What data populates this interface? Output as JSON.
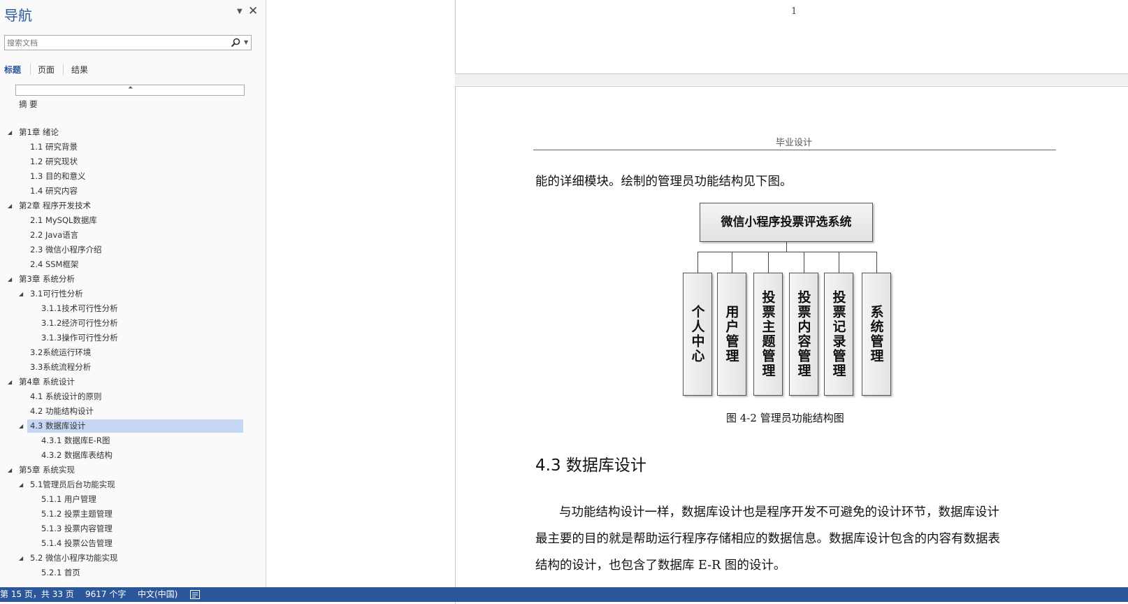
{
  "nav": {
    "title": "导航",
    "search_placeholder": "搜索文档",
    "tabs": [
      "标题",
      "页面",
      "结果"
    ],
    "headings": [
      {
        "text": "摘  要",
        "level": 0,
        "toggle": false
      },
      {
        "text": "第1章 绪论",
        "level": 0,
        "toggle": true
      },
      {
        "text": "1.1 研究背景",
        "level": 1,
        "toggle": false
      },
      {
        "text": "1.2 研究现状",
        "level": 1,
        "toggle": false
      },
      {
        "text": "1.3 目的和意义",
        "level": 1,
        "toggle": false
      },
      {
        "text": "1.4 研究内容",
        "level": 1,
        "toggle": false
      },
      {
        "text": "第2章 程序开发技术",
        "level": 0,
        "toggle": true
      },
      {
        "text": "2.1 MySQL数据库",
        "level": 1,
        "toggle": false
      },
      {
        "text": "2.2 Java语言",
        "level": 1,
        "toggle": false
      },
      {
        "text": "2.3 微信小程序介绍",
        "level": 1,
        "toggle": false
      },
      {
        "text": "2.4 SSM框架",
        "level": 1,
        "toggle": false
      },
      {
        "text": "第3章 系统分析",
        "level": 0,
        "toggle": true
      },
      {
        "text": "3.1可行性分析",
        "level": 1,
        "toggle": true
      },
      {
        "text": "3.1.1技术可行性分析",
        "level": 2,
        "toggle": false
      },
      {
        "text": "3.1.2经济可行性分析",
        "level": 2,
        "toggle": false
      },
      {
        "text": "3.1.3操作可行性分析",
        "level": 2,
        "toggle": false
      },
      {
        "text": "3.2系统运行环境",
        "level": 1,
        "toggle": false
      },
      {
        "text": "3.3系统流程分析",
        "level": 1,
        "toggle": false
      },
      {
        "text": "第4章 系统设计",
        "level": 0,
        "toggle": true
      },
      {
        "text": "4.1 系统设计的原则",
        "level": 1,
        "toggle": false
      },
      {
        "text": "4.2 功能结构设计",
        "level": 1,
        "toggle": false
      },
      {
        "text": "4.3 数据库设计",
        "level": 1,
        "toggle": true,
        "selected": true
      },
      {
        "text": "4.3.1 数据库E-R图",
        "level": 2,
        "toggle": false
      },
      {
        "text": "4.3.2 数据库表结构",
        "level": 2,
        "toggle": false
      },
      {
        "text": "第5章 系统实现",
        "level": 0,
        "toggle": true
      },
      {
        "text": "5.1管理员后台功能实现",
        "level": 1,
        "toggle": true
      },
      {
        "text": "5.1.1 用户管理",
        "level": 2,
        "toggle": false
      },
      {
        "text": "5.1.2 投票主题管理",
        "level": 2,
        "toggle": false
      },
      {
        "text": "5.1.3 投票内容管理",
        "level": 2,
        "toggle": false
      },
      {
        "text": "5.1.4 投票公告管理",
        "level": 2,
        "toggle": false
      },
      {
        "text": "5.2 微信小程序功能实现",
        "level": 1,
        "toggle": true
      },
      {
        "text": "5.2.1 首页",
        "level": 2,
        "toggle": false
      }
    ]
  },
  "document": {
    "prev_page_number": "1",
    "header_text": "毕业设计",
    "intro_line": "能的详细模块。绘制的管理员功能结构见下图。",
    "diagram": {
      "root": "微信小程序投票评选系统",
      "children": [
        "个人中心",
        "用户管理",
        "投票主题管理",
        "投票内容管理",
        "投票记录管理",
        "系统管理"
      ]
    },
    "figure_caption": "图 4-2  管理员功能结构图",
    "section_heading": "4.3  数据库设计",
    "paragraph_lines": [
      "与功能结构设计一样，数据库设计也是程序开发不可避免的设计环节，数据库设计",
      "最主要的目的就是帮助运行程序存储相应的数据信息。数据库设计包含的内容有数据表",
      "结构的设计，也包含了数据库 E-R 图的设计。"
    ]
  },
  "statusbar": {
    "page_info": "第 15 页，共 33 页",
    "word_count": "9617 个字",
    "language": "中文(中国)",
    "accent_color": "#2b579a"
  }
}
